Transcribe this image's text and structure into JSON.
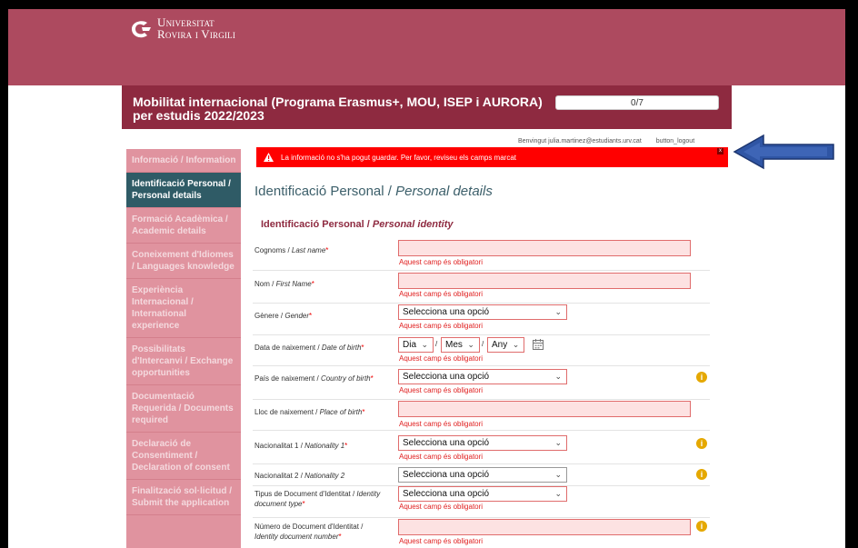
{
  "logo": {
    "line1": "Universitat",
    "line2": "Rovira i Virgili"
  },
  "banner": {
    "title": "Mobilitat internacional (Programa Erasmus+, MOU, ISEP i AURORA) per estudis 2022/2023",
    "progress": "0/7",
    "progress_fraction": 0
  },
  "sidebar": {
    "items": [
      {
        "label": "Informació / Information",
        "active": false
      },
      {
        "label": "Identificació Personal / Personal details",
        "active": true
      },
      {
        "label": "Formació Acadèmica / Academic details",
        "active": false
      },
      {
        "label": "Coneixement d'Idiomes / Languages knowledge",
        "active": false
      },
      {
        "label": "Experiència Internacional / International experience",
        "active": false
      },
      {
        "label": "Possibilitats d'Intercanvi / Exchange opportunities",
        "active": false
      },
      {
        "label": "Documentació Requerida / Documents required",
        "active": false
      },
      {
        "label": "Declaració de Consentiment / Declaration of consent",
        "active": false
      },
      {
        "label": "Finalització sol·licitud / Submit the application",
        "active": false
      }
    ]
  },
  "header": {
    "greeting": "Benvingut julia.martinez@estudiants.urv.cat",
    "logout": "button_logout"
  },
  "alert": {
    "message": "La informació no s'ha pogut guardar. Per favor, reviseu els camps marcat",
    "close": "x"
  },
  "section": {
    "title_ca": "Identificació Personal / ",
    "title_en": "Personal details",
    "subtitle_ca": "Identificació Personal / ",
    "subtitle_en": "Personal identity"
  },
  "common": {
    "required_mark": "*",
    "error": "Aquest camp és obligatori",
    "select_placeholder": "Selecciona una opció",
    "info": "i",
    "date_sep": "/"
  },
  "fields": {
    "last_name": {
      "ca": "Cognoms / ",
      "en": "Last name"
    },
    "first_name": {
      "ca": "Nom / ",
      "en": "First Name"
    },
    "gender": {
      "ca": "Gènere / ",
      "en": "Gender"
    },
    "dob": {
      "ca": "Data de naixement / ",
      "en": "Date of birth",
      "day": "Dia",
      "month": "Mes",
      "year": "Any"
    },
    "country_birth": {
      "ca": "País de naixement / ",
      "en": "Country of birth"
    },
    "place_birth": {
      "ca": "Lloc de naixement / ",
      "en": "Place of birth"
    },
    "nationality1": {
      "ca": "Nacionalitat 1 / ",
      "en": "Nationality 1"
    },
    "nationality2": {
      "ca": "Nacionalitat 2 / ",
      "en": "Nationality 2"
    },
    "doc_type": {
      "ca": "Tipus de Document d'Identitat / ",
      "en": "Identity document type"
    },
    "doc_number": {
      "ca": "Número de Document d'Identitat / ",
      "en": "Identity document number"
    }
  },
  "colors": {
    "brand": "#ad4a5f",
    "banner": "#8e2a40",
    "active_nav": "#2f5b66",
    "alert": "#ff0000",
    "error": "#e02020",
    "arrow": "#2f55a4"
  }
}
